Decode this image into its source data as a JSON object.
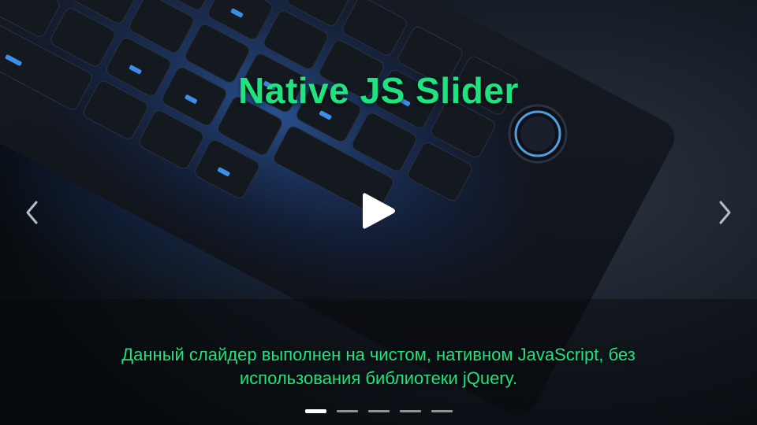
{
  "slide": {
    "title": "Native JS Slider",
    "caption": "Данный слайдер выполнен на чистом, нативном JavaScript, без использования библиотеки jQuery.",
    "background_image": "keyboard-rgb-blue-backlight",
    "accent_color": "#1ee37f"
  },
  "controls": {
    "play_icon": "play-icon",
    "prev_icon": "chevron-left-icon",
    "next_icon": "chevron-right-icon"
  },
  "indicators": {
    "count": 5,
    "active_index": 0
  }
}
